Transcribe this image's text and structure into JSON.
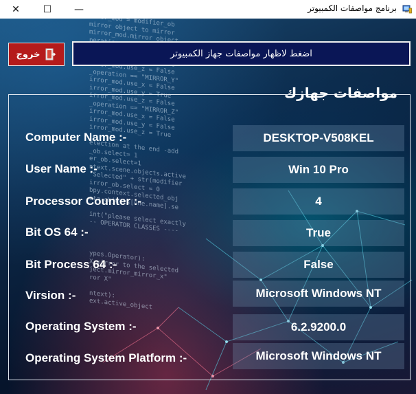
{
  "window": {
    "title": "برنامج مواصفات الكمبيوتر",
    "controls": {
      "close": "✕",
      "maximize": "☐",
      "minimize": "—"
    }
  },
  "toolbar": {
    "exit_label": "خروج",
    "show_specs_label": "اضغط لاظهار مواصفات جهاز الكمبيوتر"
  },
  "specs": {
    "title": "مواصفات جهازك",
    "rows": [
      {
        "label": "Computer Name :-",
        "value": "DESKTOP-V508KEL"
      },
      {
        "label": "User Name :-",
        "value": "Win 10 Pro"
      },
      {
        "label": "Processor Counter :-",
        "value": "4"
      },
      {
        "label": "Bit OS 64 :-",
        "value": "True"
      },
      {
        "label": "Bit Process 64 :-",
        "value": "False"
      },
      {
        "label": "Virsion :-",
        "value": "Microsoft Windows NT"
      },
      {
        "label": "Operating System :-",
        "value": "6.2.9200.0"
      },
      {
        "label": "Operating System Platform :-",
        "value": "Microsoft Windows NT"
      }
    ]
  },
  "background_code": [
    "irror_mod = modifier_ob",
    "mirror object to mirror",
    "mirror_mod.mirror_object",
    "peration == \"MIRROR_X\":",
    "irror_mod.use_x = True",
    "irror_mod.use_y = False",
    "irror_mod.use_z = False",
    "_operation == \"MIRROR_Y\"",
    "irror_mod.use_x = False",
    "irror_mod.use_y = True",
    "irror_mod.use_z = False",
    "_operation == \"MIRROR_Z\"",
    "irror_mod.use_x = False",
    "irror_mod.use_y = False",
    "irror_mod.use_z = True",
    "",
    "election at the end -add",
    "_ob.select= 1",
    "er_ob.select=1",
    "ntext.scene.objects.active",
    "\"Selected\" + str(modifier",
    "irror_ob.select = 0",
    "bpy.context.selected_obj",
    "ata.objects[one.name].se",
    "",
    "int(\"please select exactly",
    "-- OPERATOR CLASSES ----",
    "",
    "",
    "",
    "ypes.Operator):",
    "X mirror to the selected",
    "ject.mirror_mirror_x\"",
    "ror X\"",
    "",
    "ntext):",
    "ext.active_object"
  ],
  "colors": {
    "exit_button": "#b51b1b",
    "show_button": "#0a1656",
    "background_dark": "#06142b",
    "background_light": "#1b4f78"
  },
  "icons": {
    "app": "computer-app-icon",
    "exit": "exit-door-icon"
  }
}
